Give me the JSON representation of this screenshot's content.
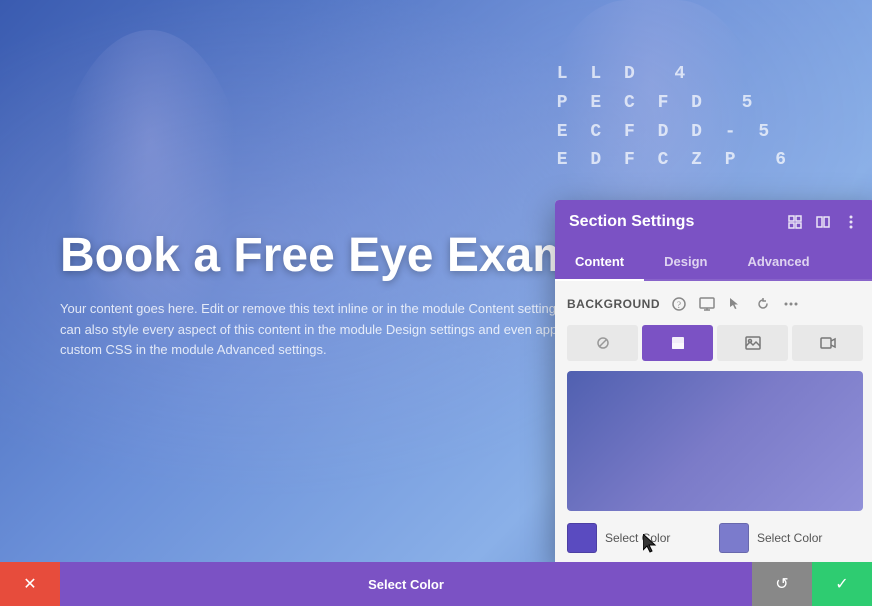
{
  "hero": {
    "title": "Book a Free Eye Exam",
    "subtitle": "Your content goes here. Edit or remove this text inline or in the module Content settings. You can also style every aspect of this content in the module Design settings and even apply custom CSS in the module Advanced settings.",
    "eye_chart_lines": [
      "P E C F D   5",
      "E C F D D - 5",
      "E D F C Z P   6",
      "L L D",
      "4",
      "5",
      "6"
    ]
  },
  "panel": {
    "title": "Section Settings",
    "header_icons": [
      "expand-icon",
      "columns-icon",
      "more-icon"
    ],
    "tabs": [
      {
        "label": "Content",
        "active": true
      },
      {
        "label": "Design",
        "active": false
      },
      {
        "label": "Advanced",
        "active": false
      }
    ],
    "background_section": {
      "label": "Background",
      "bg_type_buttons": [
        {
          "icon": "✕",
          "type": "none"
        },
        {
          "icon": "▭",
          "type": "color"
        },
        {
          "icon": "⊞",
          "type": "image"
        },
        {
          "icon": "▱",
          "type": "video"
        }
      ],
      "color_stops": [
        {
          "color": "#5a4bc0",
          "label": "Select Color"
        },
        {
          "color": "#7b7bcc",
          "label": "Select Color"
        }
      ]
    }
  },
  "bottom_toolbar": {
    "cancel_icon": "✕",
    "select_color_label": "Select Color",
    "redo_icon": "↺",
    "confirm_icon": "✓"
  },
  "colors": {
    "purple_primary": "#7b52c4",
    "cancel_red": "#e74c3c",
    "confirm_green": "#2ecc71",
    "redo_gray": "#888888"
  }
}
